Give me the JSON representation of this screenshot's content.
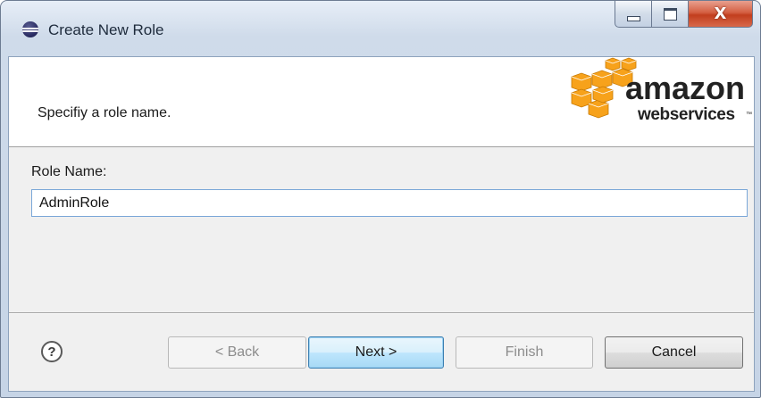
{
  "window": {
    "title": "Create New Role",
    "close_symbol": "X",
    "icons": {
      "app": "eclipse-icon",
      "minimize": "minimize-icon",
      "maximize": "maximize-icon",
      "close": "close-icon"
    }
  },
  "banner": {
    "message": "Specifiy a role name.",
    "logo": {
      "line1": "amazon",
      "line2": "webservices",
      "trademark": "™",
      "cube_color": "#f7a21b"
    }
  },
  "form": {
    "role_name_label": "Role Name:",
    "role_name_value": "AdminRole"
  },
  "buttons": {
    "help": "?",
    "back": "< Back",
    "next": "Next >",
    "finish": "Finish",
    "cancel": "Cancel"
  },
  "colors": {
    "default_button": "#bee6fd",
    "close_button": "#c9442a",
    "input_border": "#7aa7d8"
  }
}
